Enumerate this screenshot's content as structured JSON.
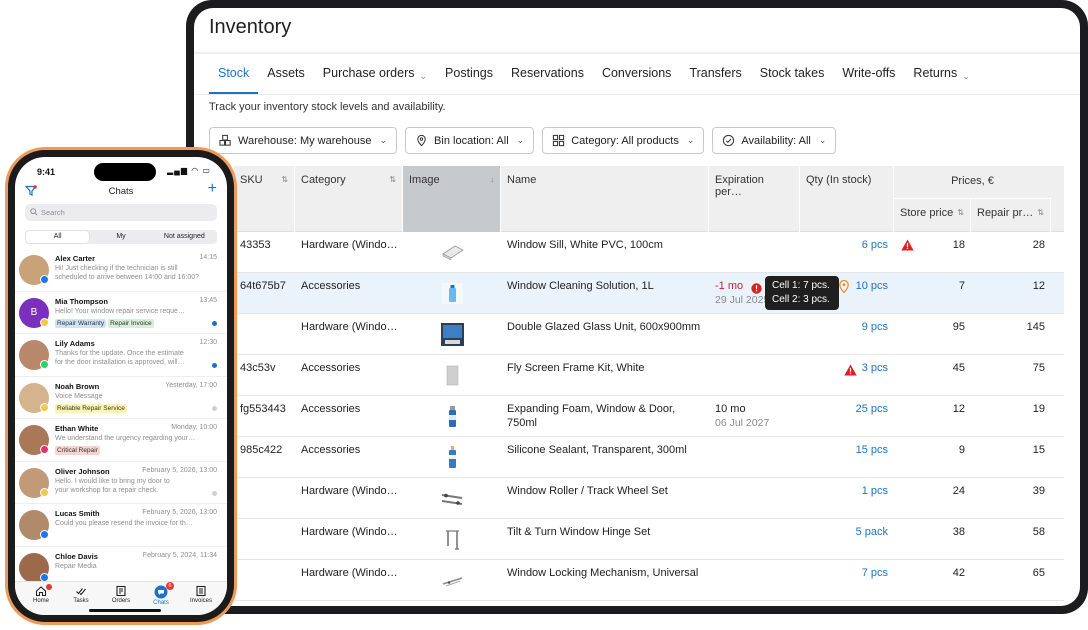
{
  "inventory": {
    "title": "Inventory",
    "tabs": [
      {
        "label": "Stock",
        "dropdown": false
      },
      {
        "label": "Assets",
        "dropdown": false
      },
      {
        "label": "Purchase orders",
        "dropdown": true
      },
      {
        "label": "Postings",
        "dropdown": false
      },
      {
        "label": "Reservations",
        "dropdown": false
      },
      {
        "label": "Conversions",
        "dropdown": false
      },
      {
        "label": "Transfers",
        "dropdown": false
      },
      {
        "label": "Stock takes",
        "dropdown": false
      },
      {
        "label": "Write-offs",
        "dropdown": false
      },
      {
        "label": "Returns",
        "dropdown": true
      }
    ],
    "description": "Track your inventory stock levels and availability.",
    "filters": {
      "warehouse": "Warehouse: My warehouse",
      "bin": "Bin location: All",
      "category": "Category: All products",
      "availability": "Availability: All"
    },
    "columns": {
      "sku": "SKU",
      "category": "Category",
      "image": "Image",
      "name": "Name",
      "expiration": "Expiration per…",
      "qty": "Qty (In stock)",
      "prices": "Prices, €",
      "store_price": "Store price",
      "repair_price": "Repair pr…"
    },
    "tooltip": {
      "line1": "Cell 1: 7 pcs.",
      "line2": "Cell 2: 3 pcs."
    },
    "rows": [
      {
        "sku": "43353",
        "category": "Hardware (Windo…",
        "name": "Window Sill, White PVC, 100cm",
        "name2": "",
        "exp": "",
        "exp2": "",
        "qty": "6 pcs",
        "store": "18",
        "repair": "28",
        "warn": true,
        "img": "sill"
      },
      {
        "sku": "64t675b7",
        "category": "Accessories",
        "name": "Window Cleaning Solution, 1L",
        "name2": "",
        "exp": "-1 mo",
        "exp2": "29 Jul 2025",
        "qty": "10 pcs",
        "store": "7",
        "repair": "12",
        "warn": false,
        "img": "bottle-blue"
      },
      {
        "sku": "",
        "category": "Hardware (Windo…",
        "name": "Double Glazed Glass Unit, 600x900mm",
        "name2": "",
        "exp": "",
        "exp2": "",
        "qty": "9 pcs",
        "store": "95",
        "repair": "145",
        "warn": false,
        "img": "glass"
      },
      {
        "sku": "43c53v",
        "category": "Accessories",
        "name": "Fly Screen Frame Kit, White",
        "name2": "",
        "exp": "",
        "exp2": "",
        "qty": "3 pcs",
        "store": "45",
        "repair": "75",
        "warn": true,
        "img": "frame"
      },
      {
        "sku": "fg553443",
        "category": "Accessories",
        "name": "Expanding Foam, Window & Door,",
        "name2": "750ml",
        "exp": "10 mo",
        "exp2": "06 Jul 2027",
        "qty": "25 pcs",
        "store": "12",
        "repair": "19",
        "warn": false,
        "img": "can"
      },
      {
        "sku": "985c422",
        "category": "Accessories",
        "name": "Silicone Sealant, Transparent, 300ml",
        "name2": "",
        "exp": "",
        "exp2": "",
        "qty": "15 pcs",
        "store": "9",
        "repair": "15",
        "warn": false,
        "img": "tube"
      },
      {
        "sku": "",
        "category": "Hardware (Windo…",
        "name": "Window Roller / Track Wheel Set",
        "name2": "",
        "exp": "",
        "exp2": "",
        "qty": "1 pcs",
        "store": "24",
        "repair": "39",
        "warn": false,
        "img": "roller"
      },
      {
        "sku": "",
        "category": "Hardware (Windo…",
        "name": "Tilt & Turn Window Hinge Set",
        "name2": "",
        "exp": "",
        "exp2": "",
        "qty": "5 pack",
        "store": "38",
        "repair": "58",
        "warn": false,
        "img": "hinge"
      },
      {
        "sku": "",
        "category": "Hardware (Windo…",
        "name": "Window Locking Mechanism, Universal",
        "name2": "",
        "exp": "",
        "exp2": "",
        "qty": "7 pcs",
        "store": "42",
        "repair": "65",
        "warn": false,
        "img": "lock"
      }
    ]
  },
  "phone": {
    "time": "9:41",
    "title": "Chats",
    "search_placeholder": "Search",
    "segments": [
      "All",
      "My",
      "Not assigned"
    ],
    "chats": [
      {
        "name": "Alex Carter",
        "time": "14:15",
        "msg1": "Hi! Just checking if the technician is still",
        "msg2": "scheduled to arrive between 14:00 and 16:00?",
        "tags": [],
        "avatar_color": "#c9a27a",
        "badge_color": "#1877f2",
        "dot": ""
      },
      {
        "name": "Mia Thompson",
        "time": "13:45",
        "msg1": "Hello! Your window repair service reque…",
        "msg2": "",
        "tags": [
          {
            "text": "Repair Warranty",
            "bg": "#cfe3f7"
          },
          {
            "text": "Repair Invoice",
            "bg": "#d7efd9"
          }
        ],
        "avatar_color": "#7b2fbf",
        "avatar_letter": "B",
        "badge_color": "#f2c94c",
        "dot": "#1a73c8"
      },
      {
        "name": "Lily Adams",
        "time": "12:30",
        "msg1": "Thanks for the update. Once the estimate",
        "msg2": "for the door installation is approved, will…",
        "tags": [],
        "avatar_color": "#b9876a",
        "badge_color": "#25d366",
        "dot": "#1a73c8"
      },
      {
        "name": "Noah Brown",
        "time": "Yesterday, 17:00",
        "msg1": "Voice Message",
        "msg2": "",
        "tags": [
          {
            "text": "Reliable Repair Service",
            "bg": "#fbf3b5"
          }
        ],
        "avatar_color": "#d4b48c",
        "badge_color": "#f2c94c",
        "dot": "#cfcfcf"
      },
      {
        "name": "Ethan White",
        "time": "Monday, 10:00",
        "msg1": "We understand the urgency regarding your…",
        "msg2": "",
        "tags": [
          {
            "text": "Critical Repair",
            "bg": "#f8d3d3"
          }
        ],
        "avatar_color": "#a87858",
        "badge_color": "#e1306c",
        "dot": ""
      },
      {
        "name": "Oliver Johnson",
        "time": "February 5, 2026, 13:00",
        "msg1": "Hello. I would like to bring my door to",
        "msg2": "your workshop for a repair check.",
        "tags": [],
        "avatar_color": "#c29a78",
        "badge_color": "#f2c94c",
        "dot": "#cfcfcf"
      },
      {
        "name": "Lucas Smith",
        "time": "February 5, 2026, 13:00",
        "msg1": "Could you please resend the invoice for th…",
        "msg2": "",
        "tags": [],
        "avatar_color": "#b08a6a",
        "badge_color": "#1877f2",
        "dot": ""
      },
      {
        "name": "Chloe Davis",
        "time": "February 5, 2024, 11:34",
        "msg1": "Repair Media",
        "msg2": "",
        "tags": [],
        "avatar_color": "#9b6a4c",
        "badge_color": "#1877f2",
        "dot": ""
      }
    ],
    "nav": [
      {
        "label": "Home",
        "icon": "home-icon"
      },
      {
        "label": "Tasks",
        "icon": "tasks-icon"
      },
      {
        "label": "Orders",
        "icon": "orders-icon"
      },
      {
        "label": "Chats",
        "icon": "chats-icon",
        "count": "6"
      },
      {
        "label": "Invoices",
        "icon": "invoices-icon"
      }
    ]
  }
}
